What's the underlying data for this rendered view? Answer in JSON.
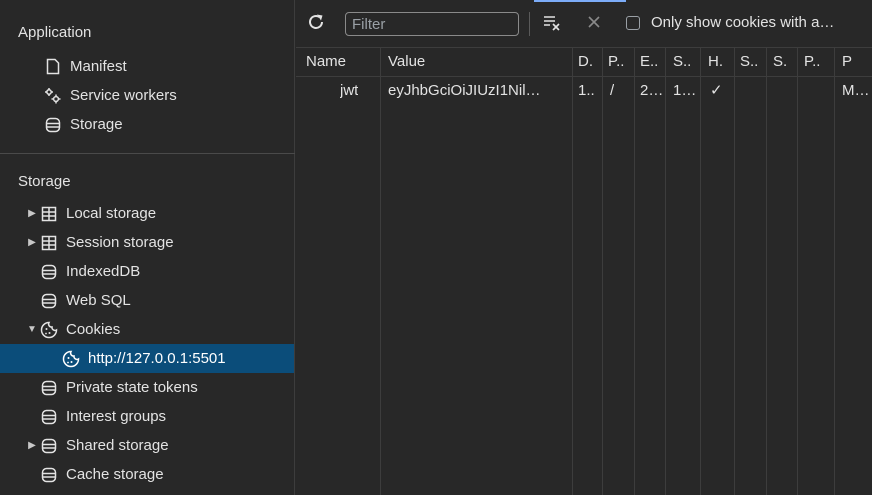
{
  "sidebar": {
    "application_header": "Application",
    "application_items": [
      {
        "label": "Manifest"
      },
      {
        "label": "Service workers"
      },
      {
        "label": "Storage"
      }
    ],
    "storage_header": "Storage",
    "storage_items": [
      {
        "label": "Local storage"
      },
      {
        "label": "Session storage"
      },
      {
        "label": "IndexedDB"
      },
      {
        "label": "Web SQL"
      },
      {
        "label": "Cookies"
      },
      {
        "label": "http://127.0.0.1:5501"
      },
      {
        "label": "Private state tokens"
      },
      {
        "label": "Interest groups"
      },
      {
        "label": "Shared storage"
      },
      {
        "label": "Cache storage"
      }
    ]
  },
  "toolbar": {
    "filter_placeholder": "Filter",
    "only_show_label": "Only show cookies with a…"
  },
  "table": {
    "columns": [
      "Name",
      "Value",
      "D.",
      "P..",
      "E..",
      "S..",
      "H.",
      "S..",
      "S.",
      "P..",
      "P"
    ],
    "rows": [
      [
        "jwt",
        "eyJhbGciOiJIUzI1Nil…",
        "1..",
        "/",
        "",
        "2…",
        "1…",
        "✓",
        "",
        "",
        "M…"
      ]
    ]
  },
  "colors": {
    "selected_bg": "#0b4d7a",
    "accent": "#7cacf8",
    "background": "#282828"
  }
}
